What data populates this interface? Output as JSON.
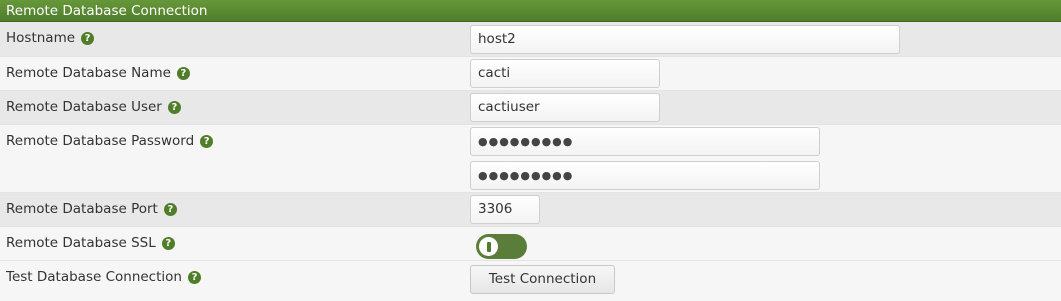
{
  "section": {
    "title": "Remote Database Connection"
  },
  "fields": {
    "hostname": {
      "label": "Hostname",
      "value": "host2"
    },
    "db_name": {
      "label": "Remote Database Name",
      "value": "cacti"
    },
    "db_user": {
      "label": "Remote Database User",
      "value": "cactiuser"
    },
    "db_password": {
      "label": "Remote Database Password",
      "value": "●●●●●●●●●",
      "confirm_value": "●●●●●●●●●"
    },
    "db_port": {
      "label": "Remote Database Port",
      "value": "3306"
    },
    "db_ssl": {
      "label": "Remote Database SSL",
      "enabled": true
    },
    "test_connection": {
      "label": "Test Database Connection",
      "button_label": "Test Connection"
    }
  },
  "help_icon_glyph": "?",
  "colors": {
    "header": "#5a8a33",
    "toggle_on": "#5a7d3a",
    "help_icon": "#4f7d2a"
  }
}
